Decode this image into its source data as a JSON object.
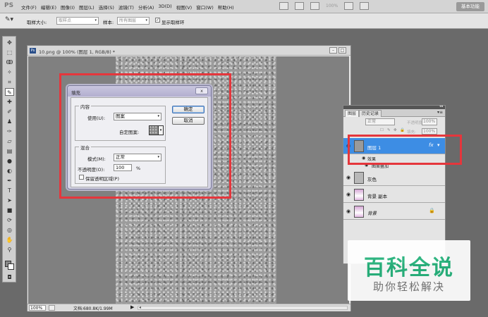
{
  "app": {
    "logo": "PS"
  },
  "menus": [
    "文件(F)",
    "编辑(E)",
    "图像(I)",
    "图层(L)",
    "选择(S)",
    "滤镜(T)",
    "分析(A)",
    "3D(D)",
    "视图(V)",
    "窗口(W)",
    "帮助(H)"
  ],
  "menubar": {
    "zoom": "100%",
    "workspace_label": "基本功能"
  },
  "options": {
    "sample_size_label": "取样大小:",
    "sample_size_value": "取样点",
    "sample_label": "样本:",
    "sample_value": "所有图层",
    "show_ring_label": "显示取样环"
  },
  "document": {
    "title": "10.png @ 100% (图层 1, RGB/8) *",
    "zoom": "100%",
    "doc_size": "文档:680.8K/1.99M"
  },
  "fill_dialog": {
    "title": "填充",
    "close": "x",
    "contents_group": "内容",
    "use_label": "使用(U):",
    "use_value": "图案",
    "custom_pattern_label": "自定图案:",
    "blending_group": "混合",
    "mode_label": "模式(M):",
    "mode_value": "正常",
    "opacity_label": "不透明度(O):",
    "opacity_value": "100",
    "opacity_unit": "%",
    "preserve_label": "保留透明区域(P)",
    "ok": "确定",
    "cancel": "取消"
  },
  "layers_panel": {
    "collapse": "◂◂",
    "tabs": [
      "图层",
      "历史记录"
    ],
    "blend_mode": "正常",
    "opacity_label": "不透明度:",
    "opacity_value": "100%",
    "fill_label": "填充:",
    "fill_value": "100%",
    "layers": [
      {
        "name": "图层 1",
        "fx": "fx"
      },
      {
        "name": "效果"
      },
      {
        "name": "图案叠加"
      },
      {
        "name": "灰色"
      },
      {
        "name": "背景 副本"
      },
      {
        "name": "背景"
      }
    ]
  },
  "watermark": {
    "title": "百科全说",
    "subtitle": "助你轻松解决"
  }
}
